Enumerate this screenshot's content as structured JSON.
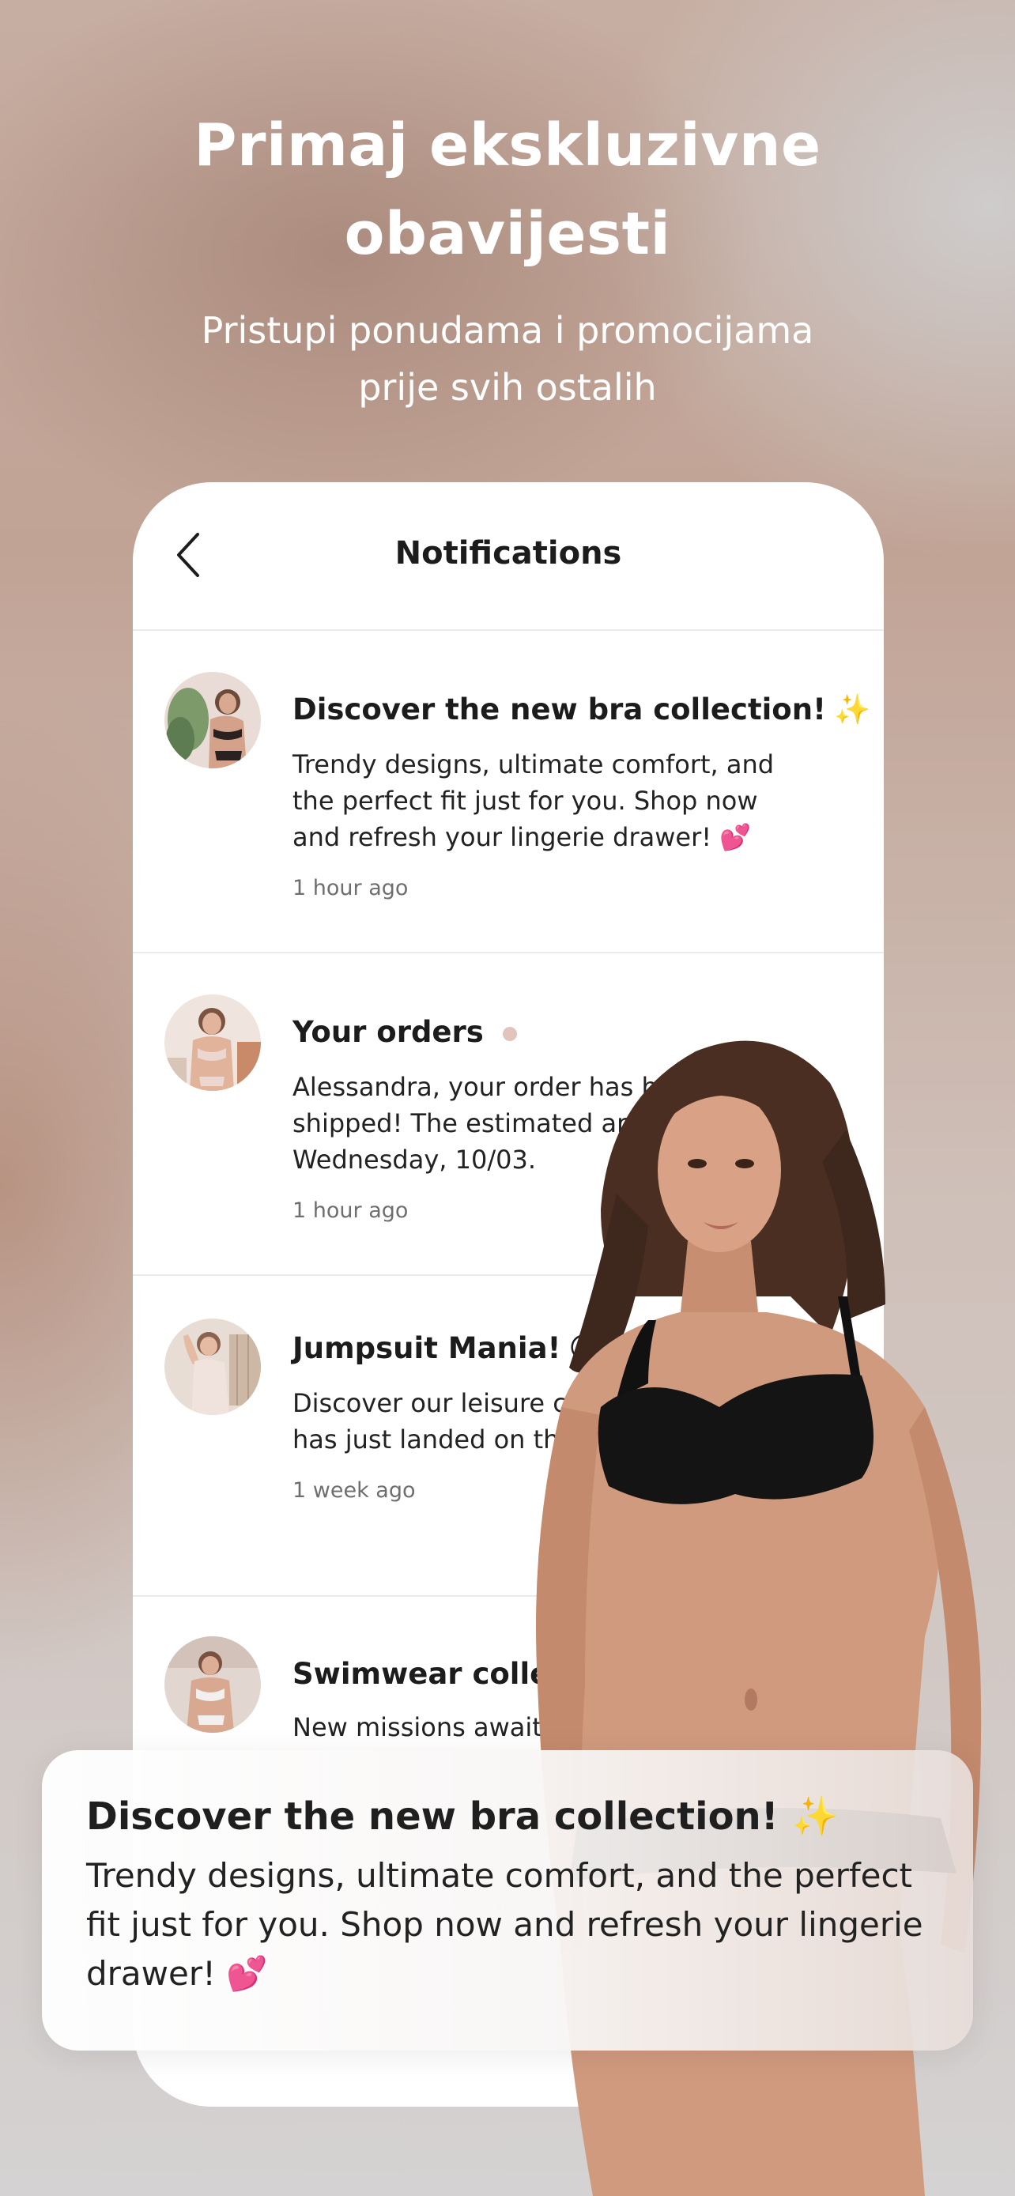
{
  "hero": {
    "title_line1": "Primaj ekskluzivne",
    "title_line2": "obavijesti",
    "subtitle_line1": "Pristupi ponudama i promocijama",
    "subtitle_line2": "prije svih ostalih"
  },
  "phone": {
    "header_title": "Notifications",
    "back_icon": "chevron-left-icon"
  },
  "notifications": [
    {
      "title": "Discover the new bra collection!",
      "emoji": "✨",
      "unread": true,
      "body_lines": [
        "Trendy designs, ultimate comfort, and",
        "the perfect fit just for you. Shop now",
        "and refresh your lingerie drawer! 💕"
      ],
      "time": "1 hour ago"
    },
    {
      "title": "Your orders",
      "emoji": "",
      "unread": true,
      "body_lines": [
        "Alessandra, your order has be",
        "shipped! The estimated arri",
        "Wednesday, 10/03."
      ],
      "time": "1 hour ago"
    },
    {
      "title": "Jumpsuit Mania!",
      "emoji": "😜",
      "unread": false,
      "body_lines": [
        "Discover our leisure colle",
        "has just landed on the"
      ],
      "time": "1 week ago"
    },
    {
      "title": "Swimwear collectio",
      "emoji": "",
      "unread": false,
      "body_lines": [
        "New missions await yo"
      ],
      "time": ""
    }
  ],
  "toast": {
    "title": "Discover the new bra collection! ✨",
    "body_lines": [
      "Trendy designs, ultimate comfort, and the perfect",
      "fit just for you. Shop now and refresh your lingerie",
      "drawer! 💕"
    ]
  },
  "colors": {
    "unread_dot": "#e2c4bd",
    "text_dark": "#1c1c1c",
    "time_text": "#6e6e6e"
  }
}
